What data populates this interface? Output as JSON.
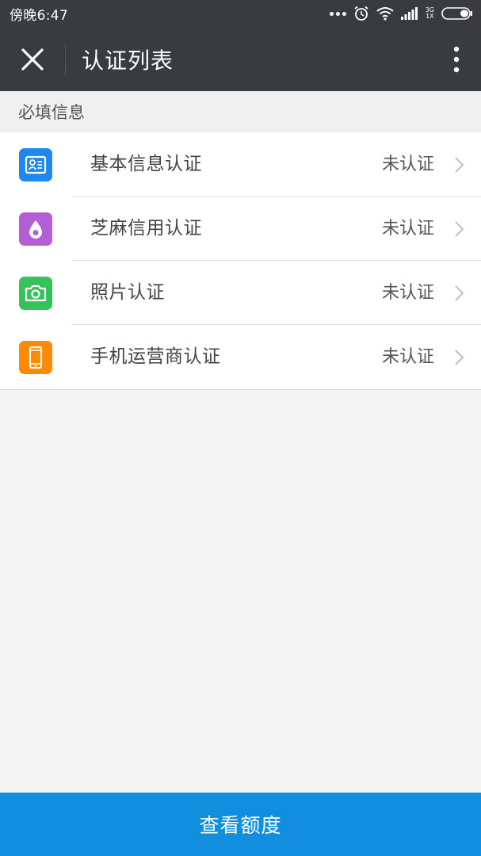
{
  "status_bar": {
    "time": "傍晚6:47",
    "network_top": "3G",
    "network_bottom": "1X",
    "icons": [
      "more-dots-icon",
      "alarm-icon",
      "wifi-icon",
      "signal-icon",
      "battery-icon"
    ]
  },
  "nav": {
    "title": "认证列表",
    "close_icon": "close-icon",
    "more_icon": "more-vertical-icon"
  },
  "section": {
    "title": "必填信息"
  },
  "items": [
    {
      "label": "基本信息认证",
      "status": "未认证",
      "icon": "id-card-icon",
      "color": "#1e87f0"
    },
    {
      "label": "芝麻信用认证",
      "status": "未认证",
      "icon": "sesame-drop-icon",
      "color": "#b35ed3"
    },
    {
      "label": "照片认证",
      "status": "未认证",
      "icon": "camera-icon",
      "color": "#35c25a"
    },
    {
      "label": "手机运营商认证",
      "status": "未认证",
      "icon": "mobile-phone-icon",
      "color": "#ff8a00"
    }
  ],
  "bottom_button": {
    "label": "查看额度",
    "color": "#118fde"
  }
}
